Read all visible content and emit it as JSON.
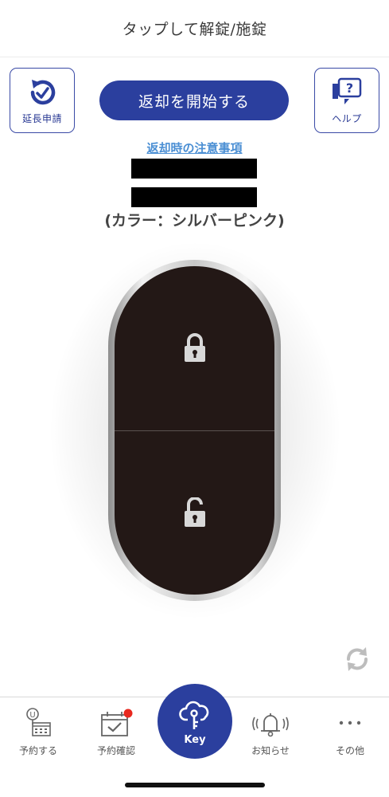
{
  "header": {
    "title": "タップして解錠/施錠"
  },
  "extension_button": {
    "label": "延長申請",
    "icon": "extension-clock-icon"
  },
  "help_button": {
    "label": "ヘルプ",
    "icon": "help-bubble-icon"
  },
  "primary_action": {
    "label": "返却を開始する"
  },
  "notice_link": {
    "label": "返却時の注意事項"
  },
  "vehicle": {
    "color_label": "(カラー：シルバーピンク)"
  },
  "key_fob": {
    "lock_icon": "lock-icon",
    "unlock_icon": "unlock-icon"
  },
  "refresh": {
    "icon": "refresh-icon"
  },
  "tabbar": {
    "items": [
      {
        "label": "予約する",
        "icon": "reserve-calendar-icon"
      },
      {
        "label": "予約確認",
        "icon": "calendar-check-icon",
        "badge": true
      },
      {
        "label": "Key",
        "icon": "cloud-key-icon",
        "active": true
      },
      {
        "label": "お知らせ",
        "icon": "bell-icon"
      },
      {
        "label": "その他",
        "icon": "more-icon"
      }
    ]
  },
  "colors": {
    "brand": "#2b3f9e",
    "link": "#4b8fd4",
    "key_body": "#231816",
    "badge": "#e8281e"
  }
}
